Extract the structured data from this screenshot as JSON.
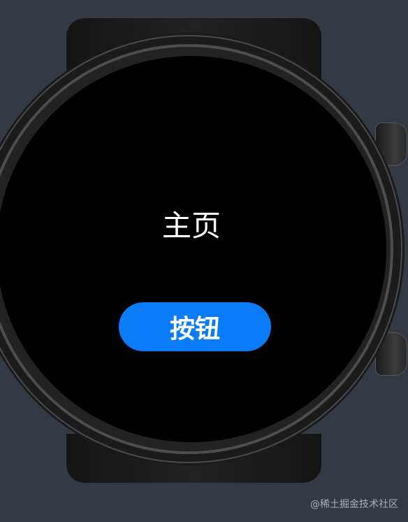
{
  "screen": {
    "title": "主页",
    "button_label": "按钮"
  },
  "watermark": "@稀土掘金技术社区",
  "colors": {
    "background": "#343a44",
    "screen": "#000000",
    "button": "#0a7cf7",
    "text": "#ffffff"
  }
}
